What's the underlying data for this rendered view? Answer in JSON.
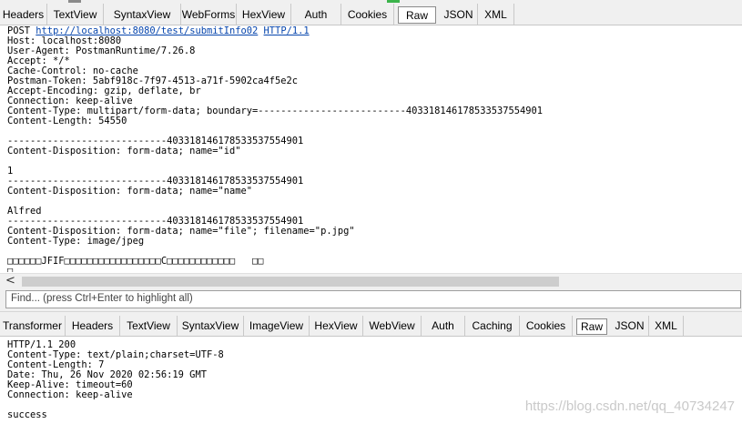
{
  "request_tabs": [
    "Headers",
    "TextView",
    "SyntaxView",
    "WebForms",
    "HexView",
    "Auth",
    "Cookies",
    "Raw",
    "JSON",
    "XML"
  ],
  "request_active_tab": "Raw",
  "request": {
    "method": "POST",
    "url": "http://localhost:8080/test/submitInfo02",
    "protocol": "HTTP/1.1",
    "lines": [
      "Host: localhost:8080",
      "User-Agent: PostmanRuntime/7.26.8",
      "Accept: */*",
      "Cache-Control: no-cache",
      "Postman-Token: 5abf918c-7f97-4513-a71f-5902ca4f5e2c",
      "Accept-Encoding: gzip, deflate, br",
      "Connection: keep-alive",
      "Content-Type: multipart/form-data; boundary=--------------------------403318146178533537554901",
      "Content-Length: 54550",
      "",
      "----------------------------403318146178533537554901",
      "Content-Disposition: form-data; name=\"id\"",
      "",
      "1",
      "----------------------------403318146178533537554901",
      "Content-Disposition: form-data; name=\"name\"",
      "",
      "Alfred",
      "----------------------------403318146178533537554901",
      "Content-Disposition: form-data; name=\"file\"; filename=\"p.jpg\"",
      "Content-Type: image/jpeg",
      "",
      "□□□□□□JFIF□□□□□□□□□□□□□□□□□C□□□□□□□□□□□□   □□",
      "□"
    ]
  },
  "find_placeholder": "Find... (press Ctrl+Enter to highlight all)",
  "response_tabs": [
    "Transformer",
    "Headers",
    "TextView",
    "SyntaxView",
    "ImageView",
    "HexView",
    "WebView",
    "Auth",
    "Caching",
    "Cookies",
    "Raw",
    "JSON",
    "XML"
  ],
  "response_active_tab": "Raw",
  "response": {
    "lines": [
      "HTTP/1.1 200",
      "Content-Type: text/plain;charset=UTF-8",
      "Content-Length: 7",
      "Date: Thu, 26 Nov 2020 02:56:19 GMT",
      "Keep-Alive: timeout=60",
      "Connection: keep-alive",
      "",
      "success"
    ]
  },
  "watermark": "https://blog.csdn.net/qq_40734247"
}
